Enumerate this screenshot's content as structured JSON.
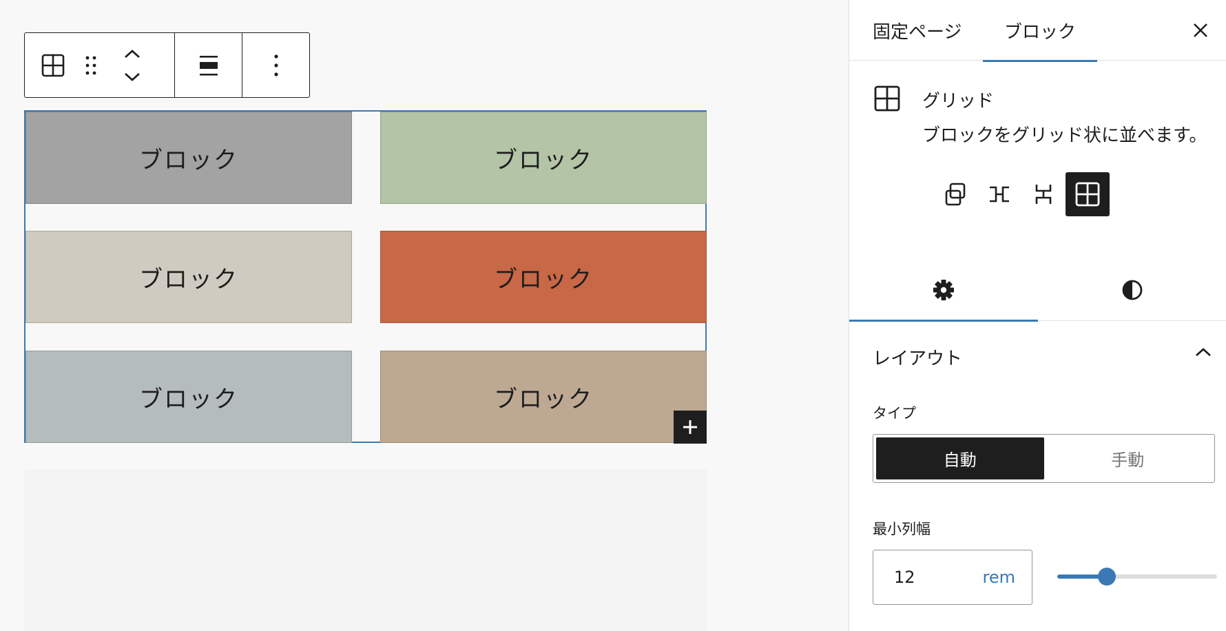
{
  "canvas": {
    "toolbar": {
      "icons": [
        "grid-icon",
        "drag-handle-icon",
        "chevron-up-icon",
        "chevron-down-icon",
        "align-icon",
        "more-vertical-icon"
      ]
    },
    "grid": {
      "cells": [
        {
          "label": "ブロック",
          "color": "#a3a3a3"
        },
        {
          "label": "ブロック",
          "color": "#b4c4a6"
        },
        {
          "label": "ブロック",
          "color": "#cfcbc0"
        },
        {
          "label": "ブロック",
          "color": "#c86846"
        },
        {
          "label": "ブロック",
          "color": "#b5bcbc"
        },
        {
          "label": "ブロック",
          "color": "#bda992"
        }
      ],
      "selection_color": "#3a79b3"
    },
    "inserter_icon": "plus-icon"
  },
  "sidebar": {
    "tabs": [
      {
        "label": "固定ページ"
      },
      {
        "label": "ブロック"
      }
    ],
    "close_icon": "close-icon",
    "block_card": {
      "title": "グリッド",
      "description": "ブロックをグリッド状に並べます。",
      "variations": [
        "group-icon",
        "row-icon",
        "stack-icon",
        "grid-icon"
      ],
      "active_variation": "grid"
    },
    "settings_tabs": [
      "gear-icon",
      "contrast-icon"
    ],
    "layout": {
      "title": "レイアウト",
      "type_label": "タイプ",
      "type_options": [
        "自動",
        "手動"
      ],
      "type_selected": "自動",
      "min_column_width_label": "最小列幅",
      "min_column_width_value": "12",
      "min_column_width_unit": "rem",
      "slider_fraction": 0.31
    }
  },
  "colors": {
    "accent": "#3a79b3",
    "dark": "#1e1e1e"
  }
}
